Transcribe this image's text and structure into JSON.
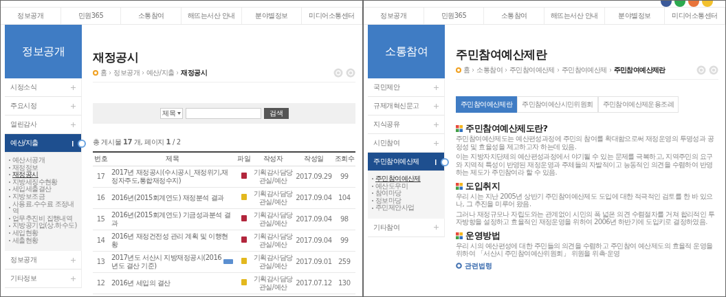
{
  "panels": [
    {
      "nav": [
        "정보공개",
        "민원365",
        "소통참여",
        "해뜨는서산 안내",
        "분야별정보",
        "미디어소통센터"
      ],
      "sidebar": {
        "title": "정보공개",
        "items": [
          {
            "label": "시정소식",
            "selected": false
          },
          {
            "label": "주요시정",
            "selected": false
          },
          {
            "label": "열린감사",
            "selected": false
          },
          {
            "label": "예산/지출",
            "selected": true,
            "children": [
              {
                "label": "예산서공개",
                "selected": false
              },
              {
                "label": "재정정보",
                "selected": false
              },
              {
                "label": "재정공시",
                "selected": true
              },
              {
                "label": "지방세징수현황",
                "selected": false
              },
              {
                "label": "세입세출결산",
                "selected": false
              },
              {
                "label": "지방보조금",
                "selected": false
              },
              {
                "label": "사용료.수수료 조정내역",
                "selected": false
              },
              {
                "label": "업무추진비 집행내역",
                "selected": false
              },
              {
                "label": "지방공기업(상.하수도)",
                "selected": false
              },
              {
                "label": "세입현황",
                "selected": false
              },
              {
                "label": "세출현황",
                "selected": false
              }
            ]
          },
          {
            "label": "정보공개",
            "selected": false
          },
          {
            "label": "기타정보",
            "selected": false
          }
        ]
      },
      "title": "재정공시",
      "breadcrumb": [
        "홈",
        "정보공개",
        "예산/지출",
        "재정공시"
      ],
      "kind": "board",
      "search": {
        "field": "제목",
        "button": "검색"
      },
      "count": "총 게시물 **17** 개, 페이지 **1** / 2",
      "columns": [
        "번호",
        "제목",
        "파일",
        "작성자",
        "작성일",
        "조회수"
      ],
      "rows": [
        {
          "no": "17",
          "title": "2017년 재정공시(수시공시_재정위기,재정자주도,통합재정수지)",
          "new": false,
          "file": {
            "color": "#b2263c"
          },
          "author": "기획감사담당관실/예산",
          "date": "2017.09.29",
          "views": "99"
        },
        {
          "no": "16",
          "title": "2016년(2015회계연도) 재정분석 결과",
          "new": false,
          "file": {
            "color": "#e3b81e"
          },
          "author": "기획감사담당관실/예산",
          "date": "2017.09.04",
          "views": "104"
        },
        {
          "no": "15",
          "title": "2016년(2015회계연도) 기금성과분석 결과",
          "new": false,
          "file": {
            "color": "#b2263c"
          },
          "author": "기획감사담당관실/예산",
          "date": "2017.09.04",
          "views": "98"
        },
        {
          "no": "14",
          "title": "2016년 재정건전성 관리 계획 및 이행현황",
          "new": false,
          "file": {
            "color": "#b2263c"
          },
          "author": "기획감사담당관실/예산",
          "date": "2017.09.04",
          "views": "99"
        },
        {
          "no": "13",
          "title": "2017년도 서산시 지방재정공시(2016년도 결산 기준)",
          "new": true,
          "file": {
            "color": "#e3b81e"
          },
          "author": "기획감사담당관실/예산",
          "date": "2017.09.01",
          "views": "259"
        },
        {
          "no": "12",
          "title": "2016년 세입의 결산",
          "new": false,
          "file": {
            "color": "#e3b81e"
          },
          "author": "기획감사담당관실/예산",
          "date": "2017.07.12",
          "views": "130"
        }
      ]
    },
    {
      "social_icons": [
        {
          "color": "#3b5998"
        },
        {
          "color": "#2ca94f"
        },
        {
          "color": "#e8743b"
        },
        {
          "color": "#f2c12e"
        }
      ],
      "nav": [
        "정보공개",
        "민원365",
        "소통참여",
        "해뜨는서산 안내",
        "분야별정보",
        "미디어소통센터"
      ],
      "sidebar": {
        "title": "소통참여",
        "items": [
          {
            "label": "국민제안",
            "selected": false
          },
          {
            "label": "규제개혁신문고",
            "selected": false
          },
          {
            "label": "지식공유",
            "selected": false
          },
          {
            "label": "시민참여",
            "selected": false
          },
          {
            "label": "주민참여예산제",
            "selected": true,
            "children": [
              {
                "label": "주민참여예산제",
                "selected": true
              },
              {
                "label": "예산도우미",
                "selected": false
              },
              {
                "label": "참여마당",
                "selected": false
              },
              {
                "label": "정보마당",
                "selected": false
              },
              {
                "label": "주민제안사업",
                "selected": false
              }
            ]
          },
          {
            "label": "기타참여",
            "selected": false
          }
        ]
      },
      "title": "주민참여예산제란",
      "breadcrumb": [
        "홈",
        "소통참여",
        "주민참여예산제",
        "주민참여예산제",
        "주민참여예산제란"
      ],
      "kind": "article",
      "tabs": [
        {
          "label": "주민참여예산제란",
          "selected": true
        },
        {
          "label": "주민참여예산시민위원회",
          "selected": false
        },
        {
          "label": "주민참여예산제운용조례",
          "selected": false
        }
      ],
      "sections": [
        {
          "heading": "주민참여예산제도란?",
          "paragraphs": [
            "주민참여예산제도는 예산편성과정에 주민의 참여를 확대함으로써 재정운영의 투명성과 공정성 및 효율성을 제고하고자 하는데 있음.",
            "이는 지방자치단체의 예산편성과정에서 야기될 수 있는 문제를 극복하고, 지역주민의 요구와 지역적 특성이 반영된 재정운영과 주체들의 자발적이고 능동적인 의견을 수렴하여 반영하는 제도가 주민참여라 할 수 있음."
          ]
        },
        {
          "heading": "도입취지",
          "paragraphs": [
            "우리 시는 지난 2005년 상반기 주민참여예산제도 도입에 대한 적극적인 검토를 한 바 있으나, 그 추진을 미루어 왔음.",
            "그러나 재정규모나 자립도와는 관계없이 시민의 폭 넓은 의견 수렴절차를 거쳐 합리적인 투자방향을 설정하고 효율적인 재정운영을 위하여 2006년 하반기에 도입키로 결정하였음."
          ]
        },
        {
          "heading": "운영방법",
          "paragraphs": [
            "우리 시의 예산편성에 대한 주민들의 의견을 수렴하고 주민참여 예산제도의 효율적 운영을 위하여 「서산시 주민참여예산위원회」 위원을 위촉·운영"
          ]
        }
      ],
      "link": "관련법령"
    }
  ]
}
